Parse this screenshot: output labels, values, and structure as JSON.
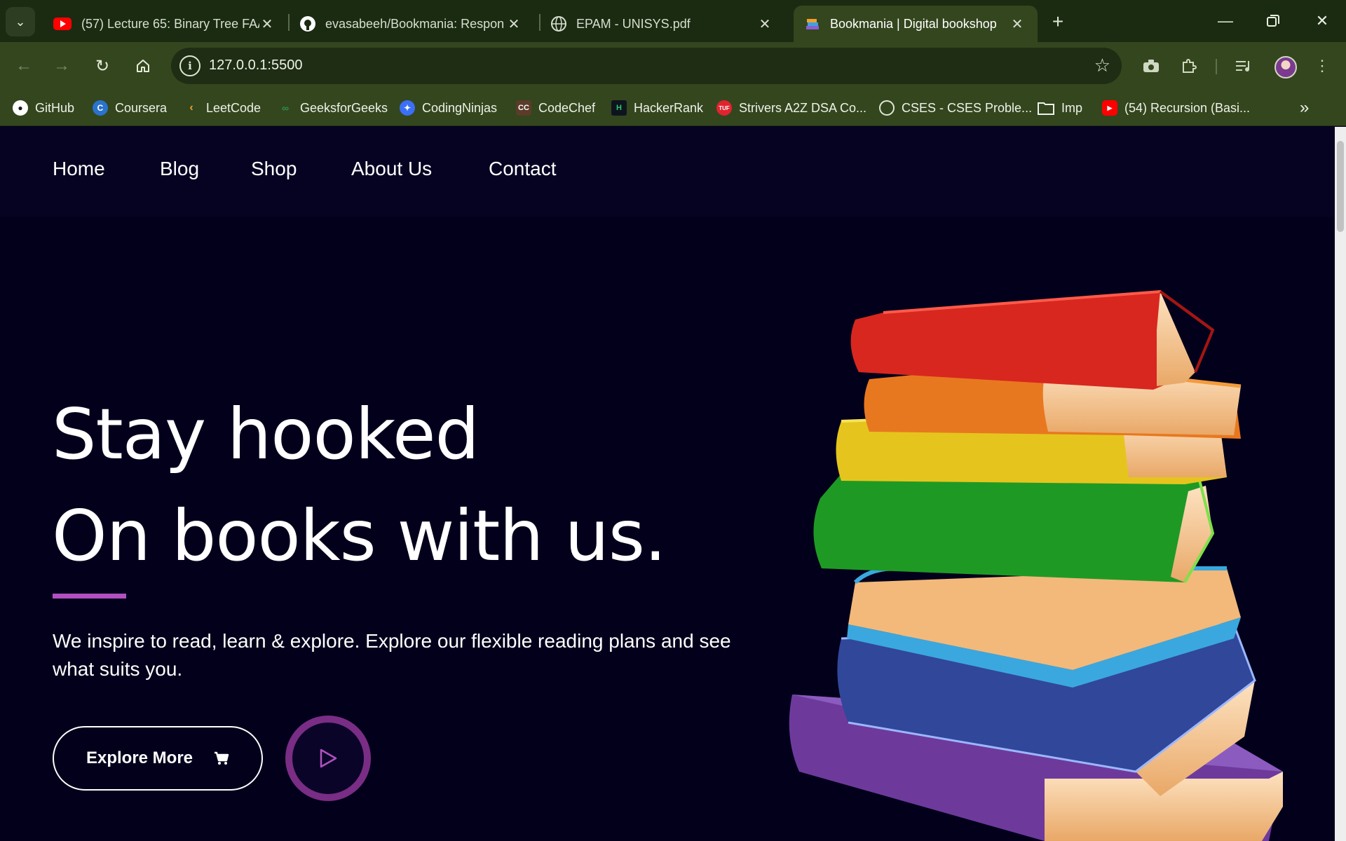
{
  "browser": {
    "tabs": [
      {
        "title": "(57) Lecture 65: Binary Tree FAA",
        "icon": "youtube-icon"
      },
      {
        "title": "evasabeeh/Bookmania: Respon",
        "icon": "github-icon"
      },
      {
        "title": "EPAM - UNISYS.pdf",
        "icon": "globe-icon"
      },
      {
        "title": "Bookmania | Digital bookshop",
        "icon": "bookmania-favicon",
        "active": true
      }
    ],
    "url": "127.0.0.1:5500",
    "bookmarks": [
      {
        "label": "GitHub",
        "icon": "github-icon"
      },
      {
        "label": "Coursera",
        "icon": "coursera-icon"
      },
      {
        "label": "LeetCode",
        "icon": "leetcode-icon"
      },
      {
        "label": "GeeksforGeeks",
        "icon": "geeksforgeeks-icon"
      },
      {
        "label": "CodingNinjas",
        "icon": "codingninjas-icon"
      },
      {
        "label": "CodeChef",
        "icon": "codechef-icon"
      },
      {
        "label": "HackerRank",
        "icon": "hackerrank-icon"
      },
      {
        "label": "Strivers A2Z DSA Co...",
        "icon": "tuf-icon"
      },
      {
        "label": "CSES - CSES Proble...",
        "icon": "globe-icon"
      },
      {
        "label": "Imp",
        "icon": "folder-icon"
      },
      {
        "label": "(54) Recursion (Basi...",
        "icon": "youtube-icon"
      }
    ]
  },
  "site": {
    "nav": [
      "Home",
      "Blog",
      "Shop",
      "About Us",
      "Contact"
    ],
    "hero": {
      "title_line1": "Stay hooked",
      "title_line2": "On books with us.",
      "description": "We inspire to read, learn & explore. Explore our flexible reading plans and see what suits you.",
      "explore_label": "Explore More"
    }
  },
  "colors": {
    "accent": "#b150c0",
    "play_ring": "#7a2d84",
    "page_bg": "#03001c"
  }
}
